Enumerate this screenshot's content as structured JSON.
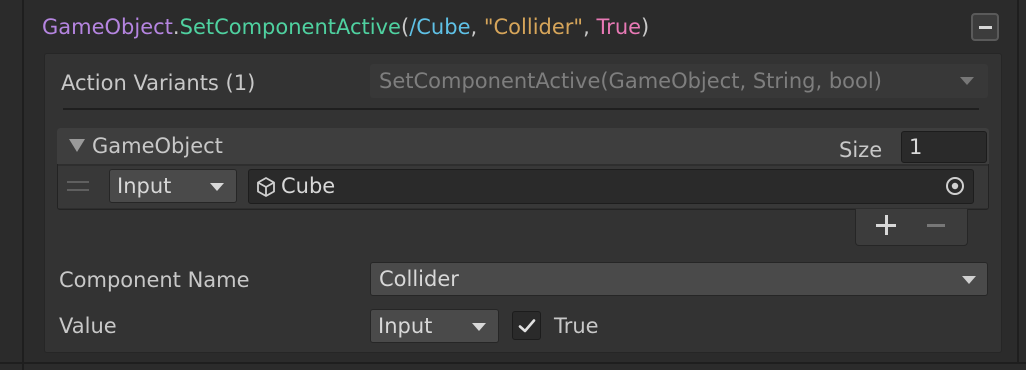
{
  "header": {
    "class_name": "GameObject",
    "dot": ".",
    "method": "SetComponentActive",
    "open_paren": "(",
    "arg_path": "/Cube",
    "comma1": ", ",
    "arg_string": "\"Collider\"",
    "comma2": ", ",
    "arg_bool": "True",
    "close_paren": ")"
  },
  "variants": {
    "label": "Action Variants (1)",
    "selected": "SetComponentActive(GameObject, String, bool)"
  },
  "gameobject_list": {
    "label": "GameObject",
    "size_label": "Size",
    "size_value": "1",
    "items": [
      {
        "mode": "Input",
        "value": "Cube",
        "icon": "cube-icon"
      }
    ]
  },
  "component": {
    "label": "Component Name",
    "selected": "Collider"
  },
  "value": {
    "label": "Value",
    "mode": "Input",
    "checked": true,
    "text": "True"
  },
  "colors": {
    "class": "#b585e0",
    "method": "#4fd1a0",
    "path": "#5fc1e6",
    "string": "#d6a55a",
    "bool": "#e879b5"
  }
}
